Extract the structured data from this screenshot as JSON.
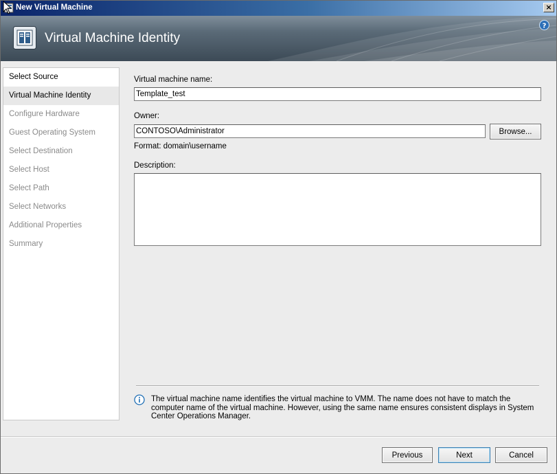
{
  "window": {
    "title": "New Virtual Machine",
    "close_glyph": "×"
  },
  "header": {
    "title": "Virtual Machine Identity",
    "icon": "server-icon",
    "help_glyph": "?"
  },
  "nav": {
    "items": [
      {
        "label": "Select Source",
        "state": "done"
      },
      {
        "label": "Virtual Machine Identity",
        "state": "active"
      },
      {
        "label": "Configure Hardware",
        "state": "pending"
      },
      {
        "label": "Guest Operating System",
        "state": "pending"
      },
      {
        "label": "Select Destination",
        "state": "pending"
      },
      {
        "label": "Select Host",
        "state": "pending"
      },
      {
        "label": "Select Path",
        "state": "pending"
      },
      {
        "label": "Select Networks",
        "state": "pending"
      },
      {
        "label": "Additional Properties",
        "state": "pending"
      },
      {
        "label": "Summary",
        "state": "pending"
      }
    ]
  },
  "form": {
    "vm_name_label": "Virtual machine name:",
    "vm_name_value": "Template_test",
    "owner_label": "Owner:",
    "owner_value": "CONTOSO\\Administrator",
    "browse_label": "Browse...",
    "format_hint": "Format: domain\\username",
    "description_label": "Description:",
    "description_value": ""
  },
  "info": {
    "text": "The virtual machine name identifies the virtual machine to VMM. The name does not have to match the computer name of the virtual machine. However, using the same name ensures consistent displays in System Center Operations Manager."
  },
  "footer": {
    "previous_label": "Previous",
    "next_label": "Next",
    "cancel_label": "Cancel"
  },
  "colors": {
    "titlebar_start": "#0a246a",
    "banner": "#4b5a66",
    "info_icon": "#1f6fb5"
  }
}
